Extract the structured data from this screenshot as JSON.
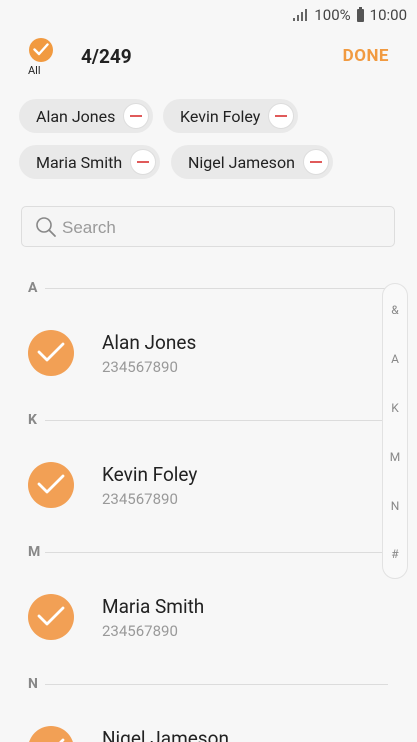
{
  "status_bar": {
    "battery": "100%",
    "time": "10:00"
  },
  "header": {
    "select_all_label": "All",
    "count": "4/249",
    "done_label": "DONE"
  },
  "selected_chips": [
    {
      "label": "Alan Jones"
    },
    {
      "label": "Kevin Foley"
    },
    {
      "label": "Maria Smith"
    },
    {
      "label": "Nigel Jameson"
    }
  ],
  "search": {
    "placeholder": "Search",
    "value": ""
  },
  "sections": [
    {
      "letter": "A",
      "contacts": [
        {
          "name": "Alan Jones",
          "number": "234567890",
          "checked": true
        }
      ]
    },
    {
      "letter": "K",
      "contacts": [
        {
          "name": "Kevin Foley",
          "number": "234567890",
          "checked": true
        }
      ]
    },
    {
      "letter": "M",
      "contacts": [
        {
          "name": "Maria Smith",
          "number": "234567890",
          "checked": true
        }
      ]
    },
    {
      "letter": "N",
      "contacts": [
        {
          "name": "Nigel Jameson",
          "number": "",
          "checked": true
        }
      ]
    }
  ],
  "index_letters": [
    "&",
    "A",
    "K",
    "M",
    "N",
    "#"
  ],
  "colors": {
    "accent": "#f19a40",
    "remove": "#e05a5a"
  },
  "icons": {
    "select_all": "check-icon",
    "chip_remove": "minus-icon",
    "search": "search-icon",
    "contact_check": "check-icon"
  }
}
